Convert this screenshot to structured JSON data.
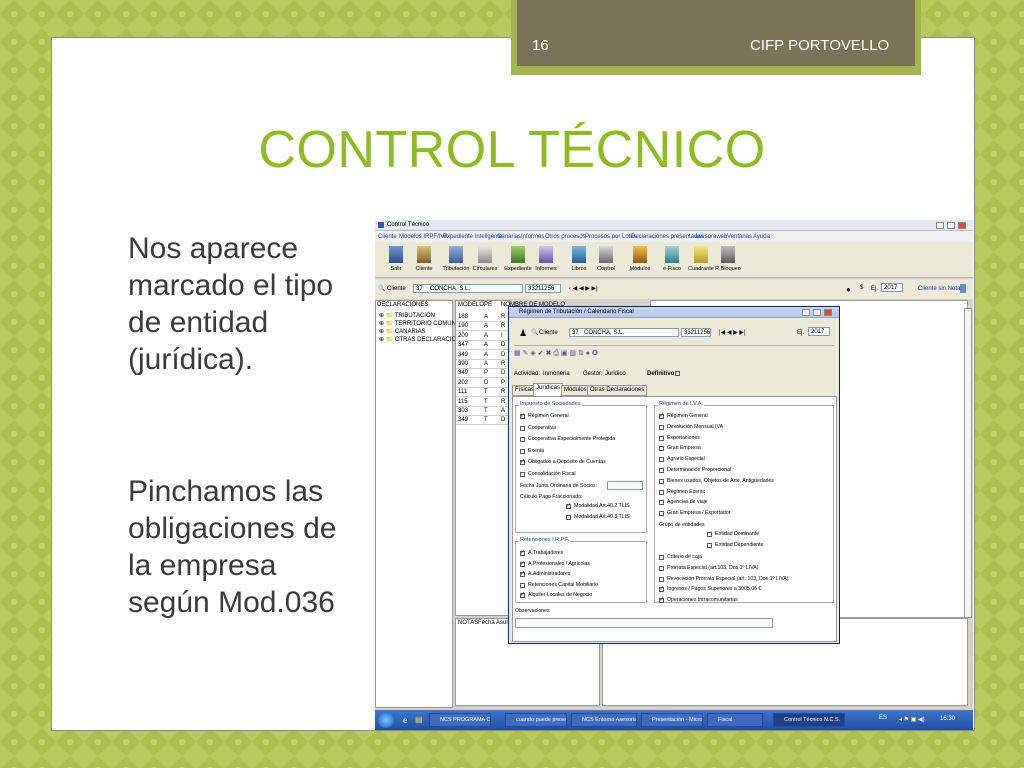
{
  "slide": {
    "number": "16",
    "header_right": "CIFP PORTOVELLO",
    "title": "CONTROL TÉCNICO",
    "bullets": [
      "Nos aparece marcado el tipo de entidad (jurídica).",
      "Pinchamos las obligaciones de la empresa según Mod.036"
    ]
  },
  "app": {
    "window_title": "Control Técnico",
    "menu": [
      "Cliente",
      "Modelos IRPF/IVA",
      "Expediente Inteligente",
      "Canarias",
      "Informes",
      "Otros procesos",
      "Procesos por Lotes",
      "Declaraciones presentadas",
      "asesoraweb",
      "Ventanas",
      "Ayuda"
    ],
    "toolbar": [
      "Salir",
      "Cliente",
      "Tributación",
      "Circulares",
      "Expediente",
      "Informes",
      "Libros",
      "Control",
      "Módulos",
      "e-Fisco",
      "Cuadrante",
      "R.Bloqueo"
    ],
    "client_label": "Cliente",
    "client_code": "37",
    "client_name": "CONCHA, S.L.",
    "client_nif": "33211256",
    "year_label": "Ej.",
    "year": "2017",
    "client_status": "Cliente sin Notas",
    "tree_header": "DECLARACIONES",
    "tree": [
      "TRIBUTACION",
      "TERRITORIO COMUN",
      "CANARIAS",
      "OTRAS DECLARACIONES"
    ],
    "grid_headers": [
      "MODELO",
      "PE",
      "NOMBRE DE MODELO"
    ],
    "grid_rows": [
      [
        "188",
        "A",
        "R"
      ],
      [
        "190",
        "A",
        "R"
      ],
      [
        "200",
        "A",
        "I"
      ],
      [
        "347",
        "A",
        "D"
      ],
      [
        "349",
        "A",
        "D"
      ],
      [
        "390",
        "A",
        "R"
      ],
      [
        "349",
        "P",
        "D"
      ],
      [
        "202",
        "D",
        "P"
      ],
      [
        "111",
        "T",
        "R"
      ],
      [
        "115",
        "T",
        "R"
      ],
      [
        "303",
        "T",
        "A"
      ],
      [
        "349",
        "T",
        "D"
      ]
    ],
    "notes_headers": [
      "NOTAS",
      "Fecha",
      "Asunto"
    ]
  },
  "dialog": {
    "title": "Régimen de Tributación / Calendario Fiscal",
    "client_label": "Cliente",
    "client_code": "37",
    "client_name": "CONCHA, S.L.",
    "client_nif": "33211256",
    "year_label": "Ej.",
    "year": "2017",
    "actividad_label": "Actividad:",
    "actividad_value": "Inmoneria",
    "gestor_label": "Gestor:",
    "gestor_value": "Juridico",
    "definitivo_label": "Definitivo",
    "tabs": [
      "Físicas",
      "Jurídicas",
      "Módulos",
      "Otras Declaraciones"
    ],
    "active_tab": "Jurídicas",
    "sociedades": {
      "title": "Impuesto de Sociedades",
      "items": [
        {
          "label": "Régimen General",
          "checked": true
        },
        {
          "label": "Cooperativa",
          "checked": false
        },
        {
          "label": "Cooperativa Especialmente Protegida",
          "checked": false
        },
        {
          "label": "Exenta",
          "checked": false
        },
        {
          "label": "Obligados a Depósito de Cuentas",
          "checked": true
        },
        {
          "label": "Consolidación Fiscal",
          "checked": false
        }
      ],
      "fecha_label": "Fecha Junta Ordinaria de Socios:",
      "calculo_label": "Cálculo Pago Fraccionado:",
      "modalidades": [
        {
          "label": "Modalidad Art.40.2 TLIS",
          "checked": true
        },
        {
          "label": "Modalidad Art.40.3 TLIS",
          "checked": false
        }
      ]
    },
    "retenciones": {
      "title": "Retenciones I.R.P.F.",
      "items": [
        {
          "label": "A.Trabajadores",
          "checked": true
        },
        {
          "label": "A.Profesionales / Agrícolas",
          "checked": true
        },
        {
          "label": "A.Administradores",
          "checked": true
        },
        {
          "label": "Retenciones Capital Mobiliario",
          "checked": false
        },
        {
          "label": "Alquiler Locales de Negocio",
          "checked": true
        }
      ]
    },
    "iva": {
      "title": "Régimen de I.V.A.",
      "items": [
        {
          "label": "Régimen General",
          "checked": true
        },
        {
          "label": "Devolución Mensual IVA",
          "checked": false
        },
        {
          "label": "Exportaciones",
          "checked": false
        },
        {
          "label": "Gran Empresa",
          "checked": false
        },
        {
          "label": "Agrario Especial",
          "checked": false
        },
        {
          "label": "Determinación Proporcional",
          "checked": false
        },
        {
          "label": "Bienes usados, Objetos de Arte, Antigüedades",
          "checked": false
        },
        {
          "label": "Régimen Exento",
          "checked": false
        },
        {
          "label": "Agencias de viaje",
          "checked": false
        },
        {
          "label": "Gran Empresa / Exportador",
          "checked": false
        }
      ],
      "grupo_label": "Grupo de entidades",
      "grupo_items": [
        {
          "label": "Entidad Dominante",
          "checked": false
        },
        {
          "label": "Entidad Dependiente",
          "checked": false
        }
      ],
      "extra_items": [
        {
          "label": "Criterio de caja",
          "checked": false
        },
        {
          "label": "Prorrata Especial (art.103, Dos.1º LIVA)",
          "checked": false
        },
        {
          "label": "Revocación Prorrata Especial (art. 103, Dos.1º LIVA)",
          "checked": false
        },
        {
          "label": "Ingresos / Pagos Superiores a 3005,06 €",
          "checked": true
        },
        {
          "label": "Operaciones Intracomunitarias",
          "checked": true
        }
      ]
    },
    "observaciones_label": "Observaciones"
  },
  "taskbar": {
    "tasks": [
      "NCS PROGRAMA CE...",
      "cuando puede prese...",
      "NCS Entorno Asesorías",
      "Presentación - Micro...",
      "Fiscal",
      "Control Técnico N.C.S."
    ],
    "active_task": "Control Técnico N.C.S.",
    "lang": "ES",
    "clock": "16:30"
  },
  "colors": {
    "title_green": "#8dbb21",
    "header_brown": "#7b7357",
    "background_green": "#b7c95a"
  }
}
